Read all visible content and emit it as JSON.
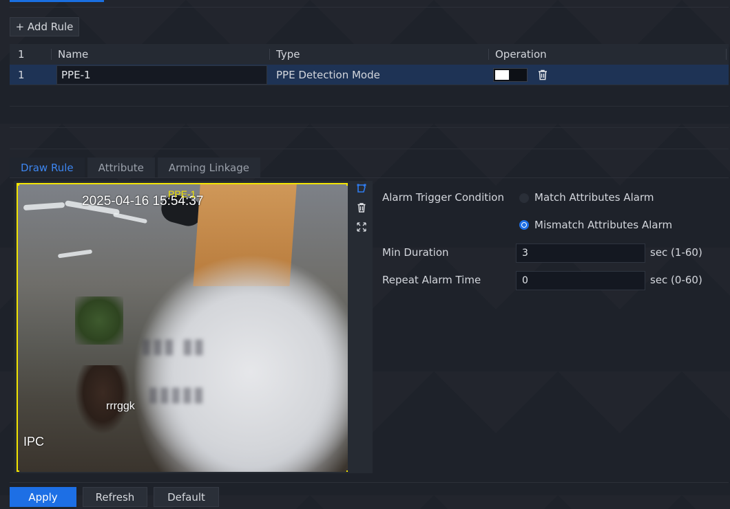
{
  "toolbar": {
    "add_rule_label": "+ Add Rule"
  },
  "rule_table": {
    "headers": {
      "index": "1",
      "name": "Name",
      "type": "Type",
      "operation": "Operation"
    },
    "rows": [
      {
        "index": "1",
        "name": "PPE-1",
        "type": "PPE Detection Mode",
        "enabled": true
      }
    ]
  },
  "tabs": [
    {
      "label": "Draw Rule",
      "active": true
    },
    {
      "label": "Attribute",
      "active": false
    },
    {
      "label": "Arming Linkage",
      "active": false
    }
  ],
  "video": {
    "timestamp": "2025-04-16 15:54:37",
    "rule_name": "PPE-1",
    "channel_name": "IPC",
    "overlay_text": "rrrggk",
    "rule_color": "#f3e600"
  },
  "video_tools": [
    "draw-region-icon",
    "trash-icon",
    "fullscreen-icon"
  ],
  "form": {
    "alarm_trigger_label": "Alarm Trigger Condition",
    "options": [
      {
        "label": "Match Attributes Alarm",
        "selected": false
      },
      {
        "label": "Mismatch Attributes Alarm",
        "selected": true
      }
    ],
    "min_duration_label": "Min Duration",
    "min_duration_value": "3",
    "min_duration_unit": "sec (1-60)",
    "repeat_alarm_label": "Repeat Alarm Time",
    "repeat_alarm_value": "0",
    "repeat_alarm_unit": "sec (0-60)"
  },
  "footer": {
    "apply_label": "Apply",
    "refresh_label": "Refresh",
    "default_label": "Default"
  },
  "colors": {
    "accent": "#1d6fe5",
    "selected_row": "#1e3355",
    "background": "#1e222a"
  }
}
